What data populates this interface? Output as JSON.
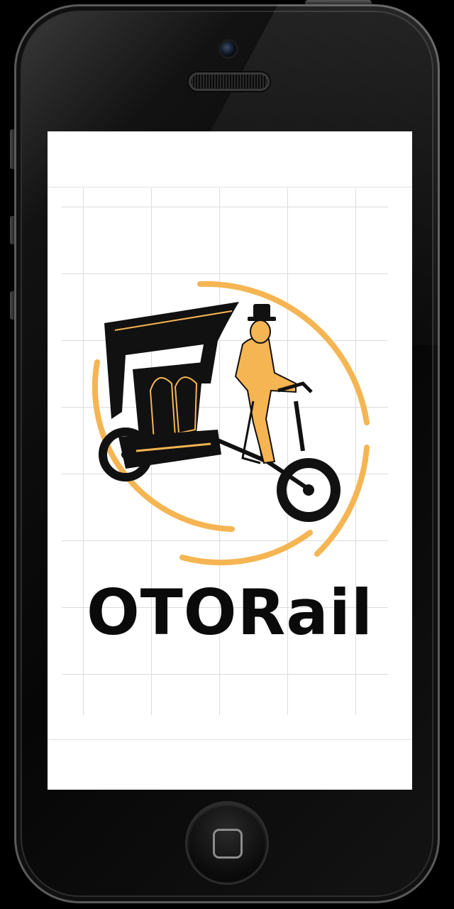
{
  "device": {
    "type": "smartphone"
  },
  "screen": {
    "brand_logo": {
      "wordmark": "OTORail",
      "icon": "pedicab-rider-icon",
      "colors": {
        "primary": "#0a0a0a",
        "accent": "#f5b553",
        "background": "#ffffff",
        "grid": "#dcdcdc"
      }
    }
  },
  "hardware": {
    "home_button_icon": "home-square-icon",
    "camera_icon": "front-camera-icon",
    "speaker_icon": "earpiece-speaker-icon"
  }
}
